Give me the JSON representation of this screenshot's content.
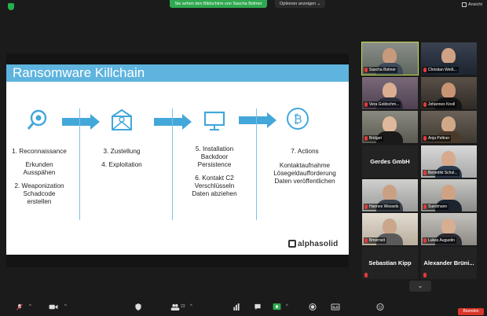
{
  "top_bar": {
    "share_banner": "Sie sehen den Bildschirm von Sascha Bolmer",
    "view_options": "Optionen anzeigen ⌄",
    "view_label": "Ansicht"
  },
  "slide": {
    "title": "Ransomware Killchain",
    "col1": [
      "1. Reconnaissance",
      "Erkunden",
      "Ausspähen",
      "2. Weaponization",
      "Schadcode",
      "erstellen"
    ],
    "col2": [
      "3. Zustellung",
      "4. Exploitation"
    ],
    "col3": [
      "5. Installation",
      "Backdoor",
      "Persistence",
      "6. Kontakt C2",
      "Verschlüsseln",
      "Daten abziehen"
    ],
    "col4": [
      "7. Actions",
      "Kontaktaufnahme",
      "Lösegeldaufforderung",
      "Daten veröffentlichen"
    ],
    "logo": "alphasolid",
    "icon_color": "#43a7da"
  },
  "participants": [
    {
      "name": "Sascha Bolmer"
    },
    {
      "name": "Christian Weiß..."
    },
    {
      "name": "Vera Goldschm..."
    },
    {
      "name": "Johannes Knoll"
    },
    {
      "name": "Bridget"
    },
    {
      "name": "Anja Peltner"
    },
    {
      "name": "Gerdes GmbH"
    },
    {
      "name": "Benedikt Schul..."
    },
    {
      "name": "Hannes Wessels"
    },
    {
      "name": "Suedmann"
    },
    {
      "name": "Bmorneit"
    },
    {
      "name": "Lukas Augustin"
    },
    {
      "name": "Sebastian Kipp"
    },
    {
      "name": "Alexander  Brüni..."
    }
  ],
  "toolbar": {
    "participant_count": "23",
    "end_label": "Beenden",
    "accent": "#d9372b",
    "share_color": "#2fa84f"
  }
}
